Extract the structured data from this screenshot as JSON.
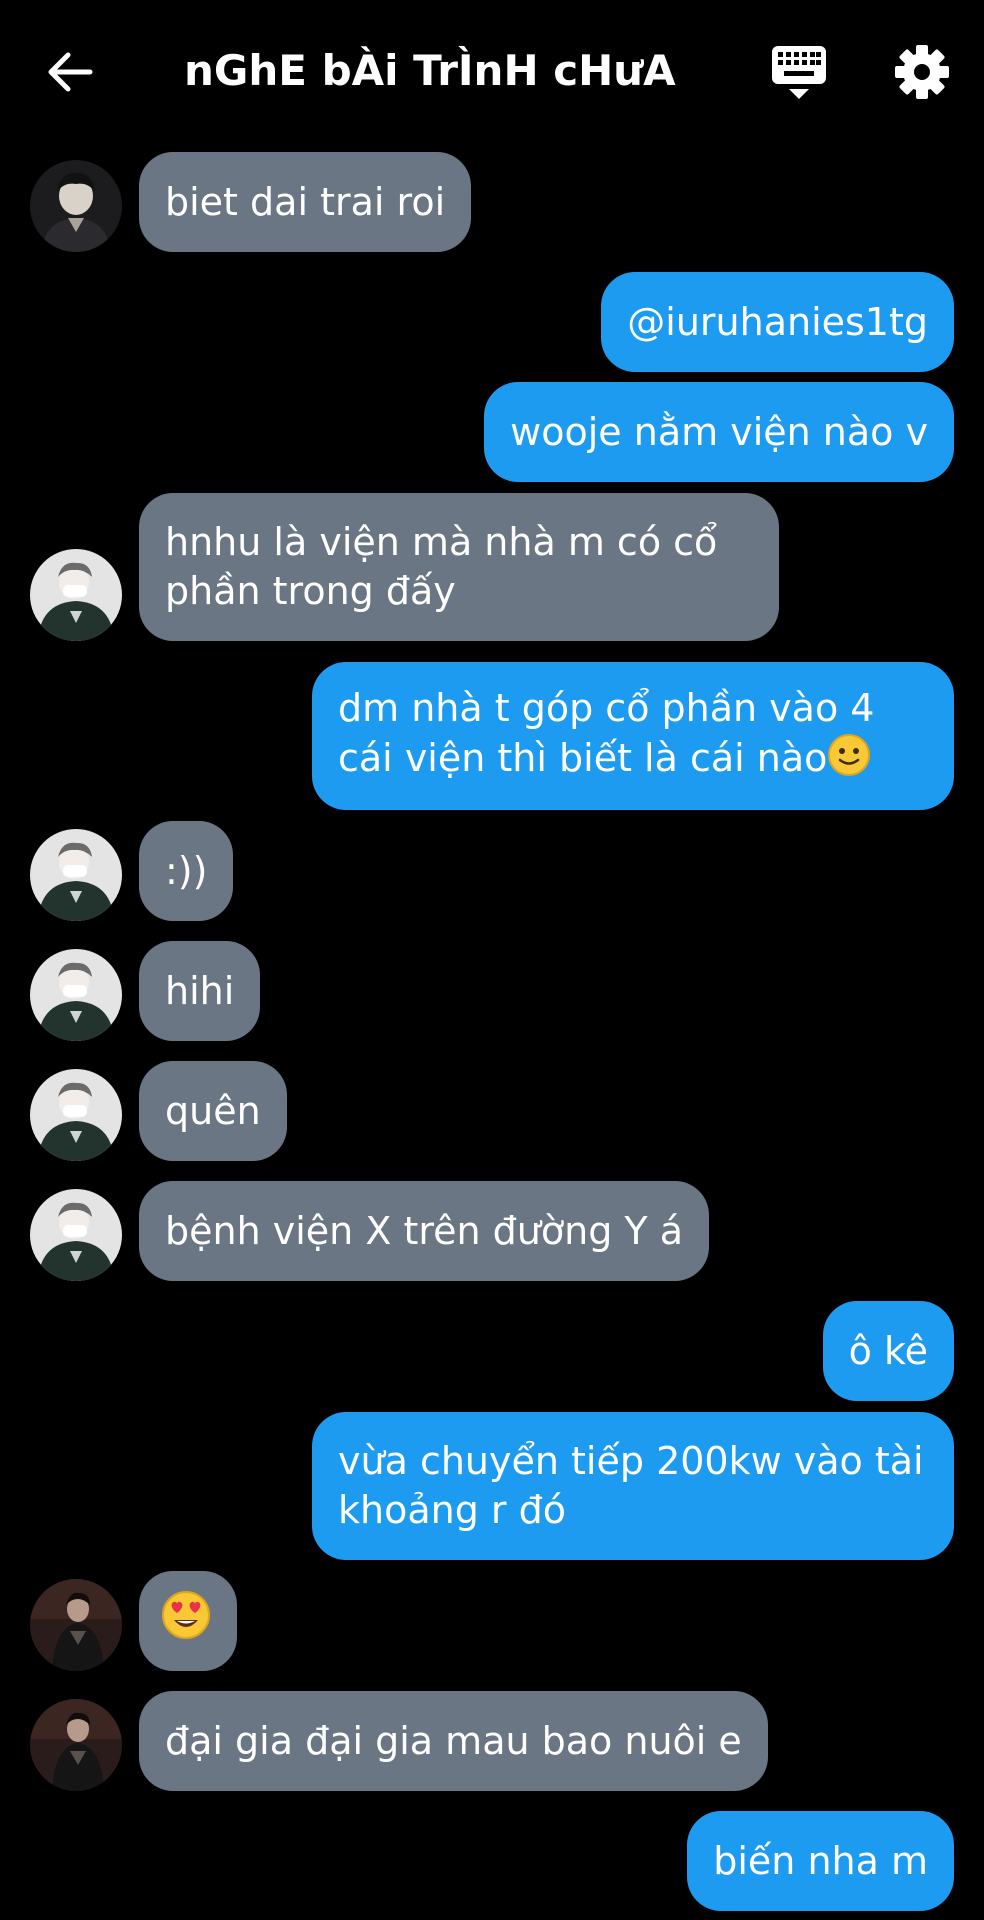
{
  "header": {
    "title": "nGhE bÀi TrÌnH cHưA",
    "back_icon": "arrow-left-icon",
    "keyboard_icon": "keyboard-icon",
    "settings_icon": "gear-icon"
  },
  "colors": {
    "background": "#000000",
    "received_bubble": "#6a7683",
    "sent_bubble": "#1d9bf0",
    "text": "#ffffff"
  },
  "messages": [
    {
      "side": "received",
      "avatar": "user-a",
      "text": "biet dai trai roi"
    },
    {
      "side": "sent",
      "text": "@iuruhanies1tg"
    },
    {
      "side": "sent",
      "text": "wooje nằm viện nào v"
    },
    {
      "side": "received",
      "avatar": "user-b",
      "text": "hnhu là viện mà nhà m có cổ phần trong đấy"
    },
    {
      "side": "sent",
      "text": "dm nhà t góp cổ phần vào 4 cái viện thì biết là cái nào",
      "trailing_emoji": "slightly-smiling-face-emoji"
    },
    {
      "side": "received",
      "avatar": "user-b",
      "text": ":))"
    },
    {
      "side": "received",
      "avatar": "user-b",
      "text": "hihi"
    },
    {
      "side": "received",
      "avatar": "user-b",
      "text": "quên"
    },
    {
      "side": "received",
      "avatar": "user-b",
      "text": "bệnh viện X trên đường Y á"
    },
    {
      "side": "sent",
      "text": "ô kê"
    },
    {
      "side": "sent",
      "text": "vừa chuyển tiếp 200kw vào tài khoảng r đó"
    },
    {
      "side": "received",
      "avatar": "user-c",
      "text": "",
      "emoji": "heart-eyes-emoji"
    },
    {
      "side": "received",
      "avatar": "user-c",
      "text": "đại gia đại gia mau bao nuôi e"
    },
    {
      "side": "sent",
      "text": "biến nha m"
    }
  ]
}
